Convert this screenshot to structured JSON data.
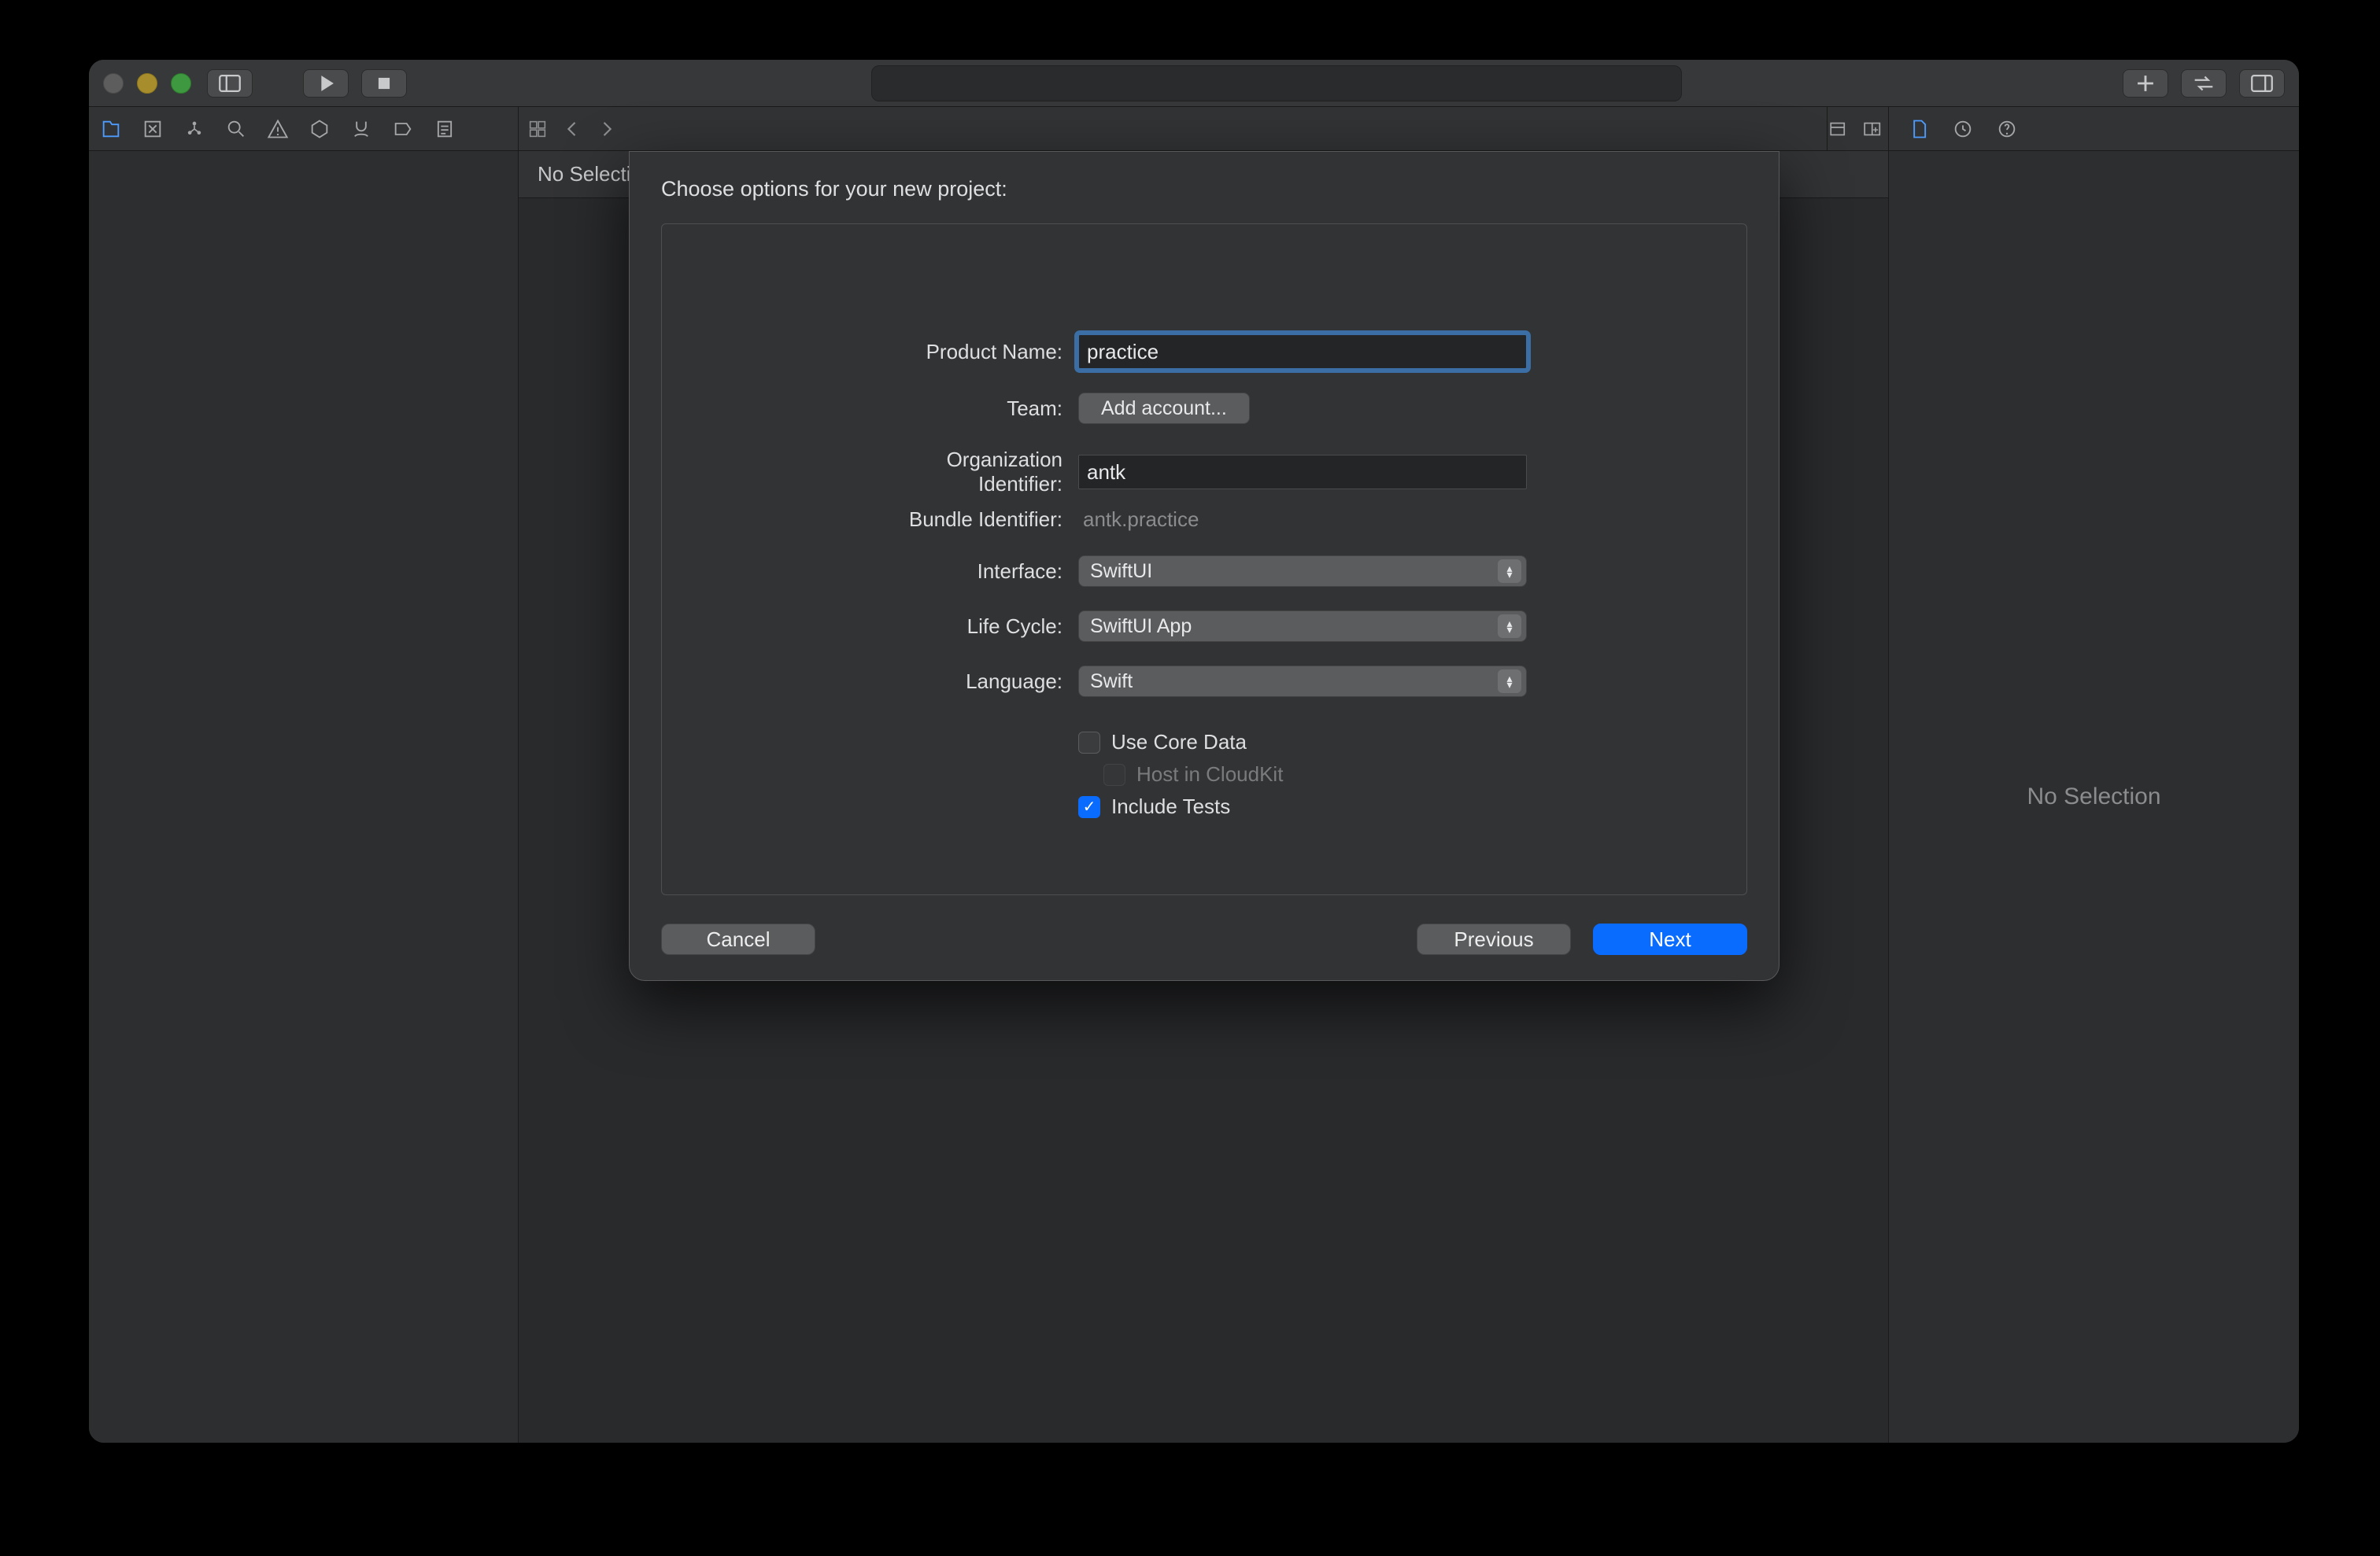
{
  "breadcrumb": "No Selection",
  "inspector_empty": "No Selection",
  "sheet": {
    "title": "Choose options for your new project:",
    "labels": {
      "product_name": "Product Name:",
      "team": "Team:",
      "org_id": "Organization Identifier:",
      "bundle_id": "Bundle Identifier:",
      "interface": "Interface:",
      "life_cycle": "Life Cycle:",
      "language": "Language:"
    },
    "values": {
      "product_name": "practice",
      "team_button": "Add account...",
      "org_id": "antk",
      "bundle_id": "antk.practice",
      "interface": "SwiftUI",
      "life_cycle": "SwiftUI App",
      "language": "Swift"
    },
    "checkboxes": {
      "core_data": {
        "label": "Use Core Data",
        "checked": false,
        "disabled": false
      },
      "cloudkit": {
        "label": "Host in CloudKit",
        "checked": false,
        "disabled": true
      },
      "tests": {
        "label": "Include Tests",
        "checked": true,
        "disabled": false
      }
    },
    "buttons": {
      "cancel": "Cancel",
      "previous": "Previous",
      "next": "Next"
    }
  }
}
